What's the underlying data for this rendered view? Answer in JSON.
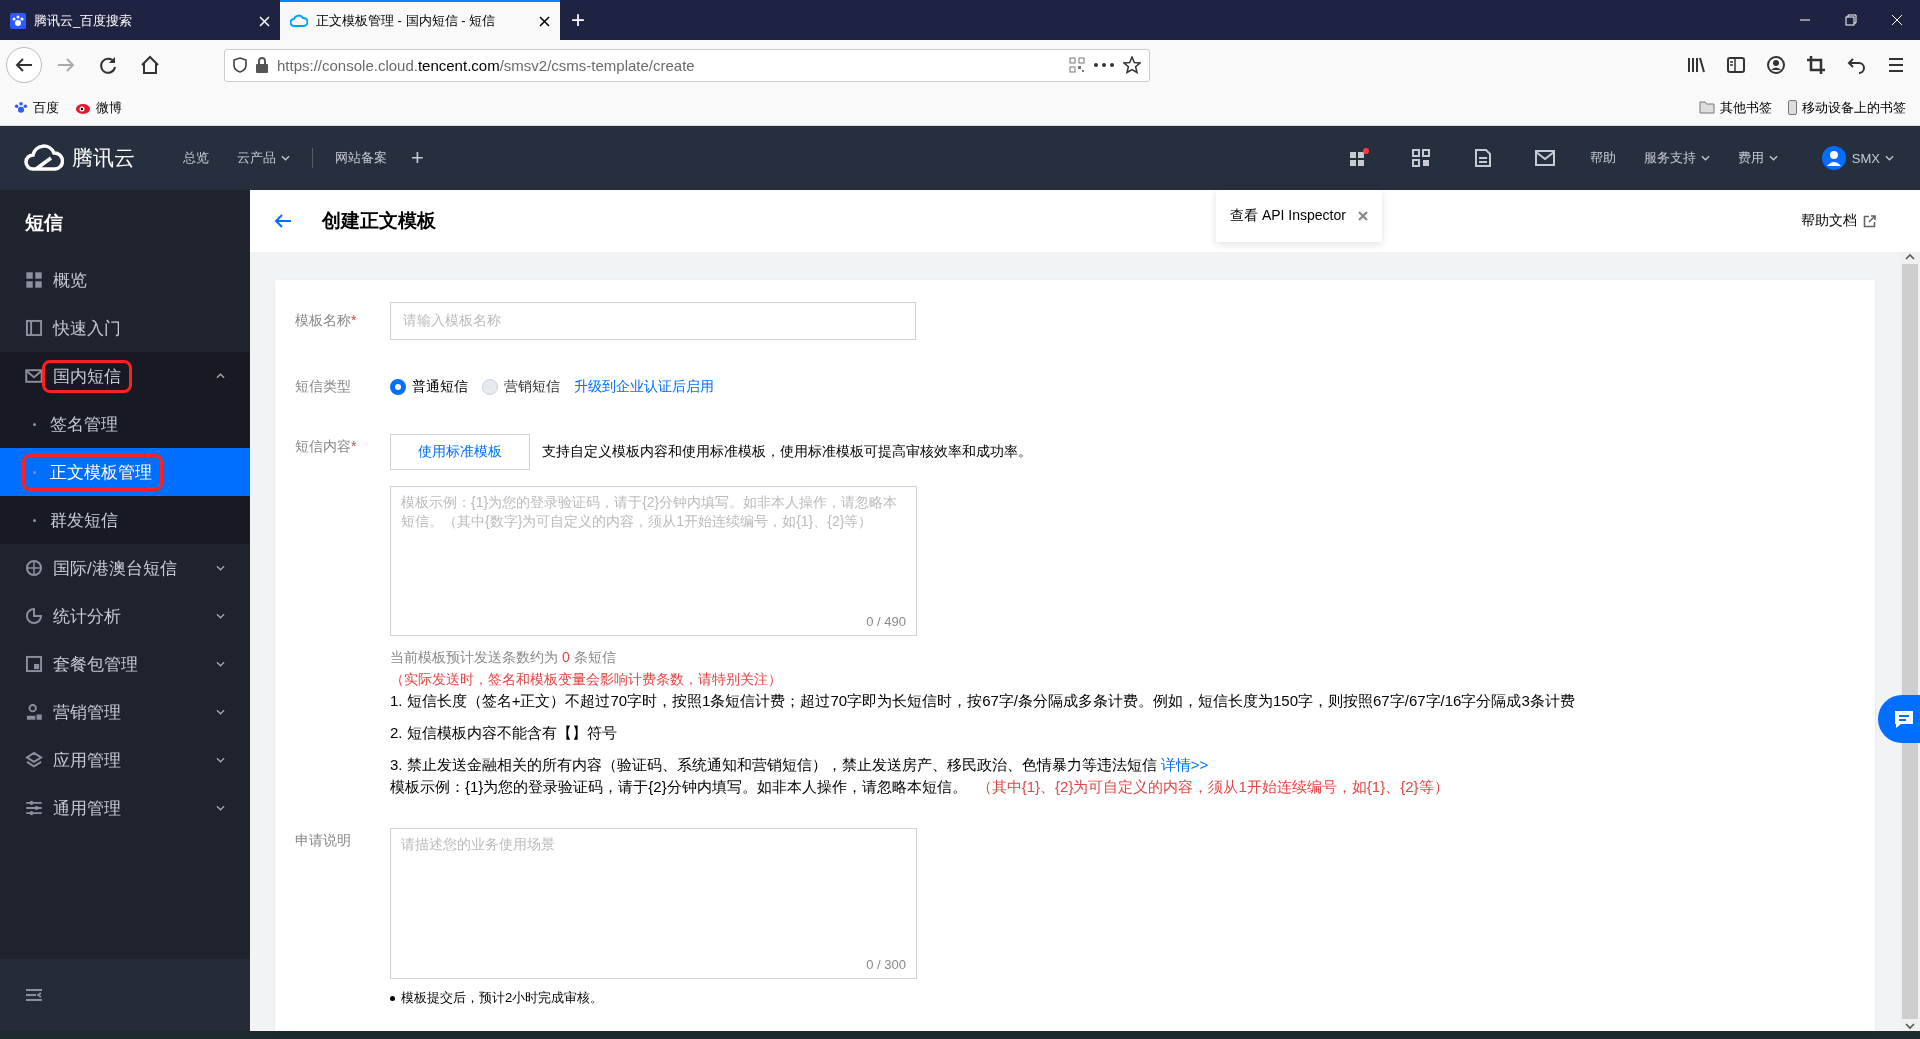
{
  "browser": {
    "tabs": [
      {
        "title": "腾讯云_百度搜索",
        "selected": false
      },
      {
        "title": "正文模板管理 - 国内短信 - 短信",
        "selected": true
      }
    ],
    "url_scheme": "https://console.cloud.",
    "url_domain": "tencent.com",
    "url_path": "/smsv2/csms-template/create",
    "bookmarks": [
      "百度",
      "微博"
    ],
    "bookmarks_right": [
      "其他书签",
      "移动设备上的书签"
    ]
  },
  "topnav": {
    "logo": "腾讯云",
    "menu": [
      {
        "label": "总览",
        "dropdown": false
      },
      {
        "label": "云产品",
        "dropdown": true
      },
      {
        "label": "网站备案",
        "dropdown": false
      }
    ],
    "add": "+",
    "right_menu": [
      {
        "label": "帮助",
        "dropdown": false
      },
      {
        "label": "服务支持",
        "dropdown": true
      },
      {
        "label": "费用",
        "dropdown": true
      }
    ],
    "user": "SMX"
  },
  "sidebar": {
    "title": "短信",
    "items": [
      {
        "label": "概览",
        "kind": "link"
      },
      {
        "label": "快速入门",
        "kind": "link"
      },
      {
        "label": "国内短信",
        "kind": "group",
        "expanded": true,
        "highlighted": true,
        "children": [
          {
            "label": "签名管理",
            "selected": false,
            "highlighted": false
          },
          {
            "label": "正文模板管理",
            "selected": true,
            "highlighted": true
          },
          {
            "label": "群发短信",
            "selected": false,
            "highlighted": false
          }
        ]
      },
      {
        "label": "国际/港澳台短信",
        "kind": "group",
        "expanded": false,
        "highlighted": false
      },
      {
        "label": "统计分析",
        "kind": "group",
        "expanded": false,
        "highlighted": false
      },
      {
        "label": "套餐包管理",
        "kind": "group",
        "expanded": false,
        "highlighted": false
      },
      {
        "label": "营销管理",
        "kind": "group",
        "expanded": false,
        "highlighted": false
      },
      {
        "label": "应用管理",
        "kind": "group",
        "expanded": false,
        "highlighted": false
      },
      {
        "label": "通用管理",
        "kind": "group",
        "expanded": false,
        "highlighted": false
      }
    ]
  },
  "page": {
    "title": "创建正文模板",
    "tooltip": "查看 API Inspector",
    "help_link": "帮助文档"
  },
  "form": {
    "required_mark": "*",
    "name_label": "模板名称",
    "name_placeholder": "请输入模板名称",
    "type_label": "短信类型",
    "types": [
      {
        "label": "普通短信",
        "selected": true,
        "disabled": false
      },
      {
        "label": "营销短信",
        "selected": false,
        "disabled": true
      }
    ],
    "type_link": "升级到企业认证后启用",
    "content_label": "短信内容",
    "standard_button": "使用标准模板",
    "standard_hint": "支持自定义模板内容和使用标准模板，使用标准模板可提高审核效率和成功率。",
    "content_placeholder": "模板示例：{1}为您的登录验证码，请于{2}分钟内填写。如非本人操作，请忽略本短信。（其中{数字}为可自定义的内容，须从1开始连续编号，如{1}、{2}等）",
    "content_counter": "0 / 490",
    "estimate_prefix": "当前模板预计发送条数约为 ",
    "estimate_value": "0",
    "estimate_suffix": " 条短信",
    "estimate_note": "（实际发送时，签名和模板变量会影响计费条数，请特别关注）",
    "rules": [
      "1. 短信长度（签名+正文）不超过70字时，按照1条短信计费；超过70字即为长短信时，按67字/条分隔成多条计费。例如，短信长度为150字，则按照67字/67字/16字分隔成3条计费",
      "2. 短信模板内容不能含有【】符号",
      "3. 禁止发送金融相关的所有内容（验证码、系统通知和营销短信），禁止发送房产、移民政治、色情暴力等违法短信 "
    ],
    "rules_link": "详情>>",
    "example": "模板示例：{1}为您的登录验证码，请于{2}分钟内填写。如非本人操作，请忽略本短信。",
    "example_note": "（其中{1}、{2}为可自定义的内容，须从1开始连续编号，如{1}、{2}等）",
    "reason_label": "申请说明",
    "reason_placeholder": "请描述您的业务使用场景",
    "reason_counter": "0 / 300",
    "footnote": "模板提交后，预计2小时完成审核。"
  }
}
